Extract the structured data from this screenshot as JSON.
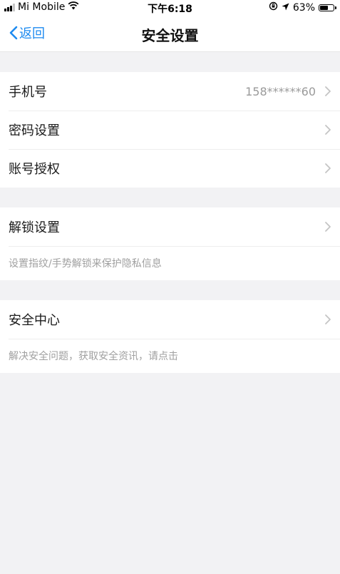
{
  "status_bar": {
    "carrier": "Mi Mobile",
    "time": "下午6:18",
    "battery": "63%",
    "battery_level": 0.63
  },
  "nav": {
    "back_label": "返回",
    "title": "安全设置"
  },
  "groups": {
    "account": {
      "phone_label": "手机号",
      "phone_value": "158******60",
      "password_label": "密码设置",
      "authorize_label": "账号授权"
    },
    "unlock": {
      "label": "解锁设置",
      "hint": "设置指纹/手势解锁来保护隐私信息"
    },
    "security_center": {
      "label": "安全中心",
      "hint": "解决安全问题，获取安全资讯，请点击"
    }
  }
}
